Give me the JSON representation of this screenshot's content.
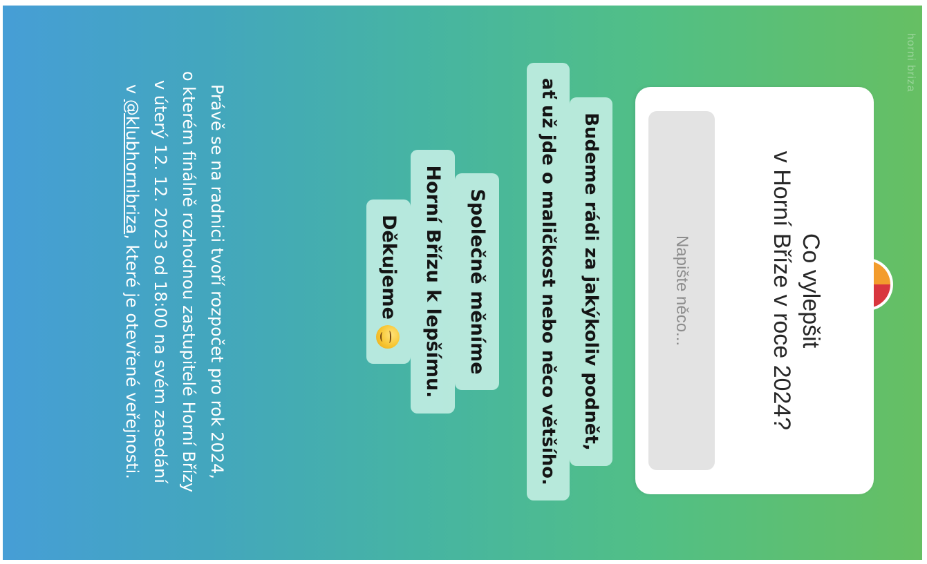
{
  "story": {
    "watermark": "horni briza",
    "question_card": {
      "title_lines": [
        "Co vylepšit",
        "v Horní Bříze v roce 2024?"
      ],
      "input_placeholder": "Napište něco..."
    },
    "highlight_1": {
      "lines": [
        "Budeme rádi za jakýkoliv podnět,",
        "ať už jde o maličkost nebo něco většího."
      ]
    },
    "highlight_2": {
      "lines": [
        "Společně měníme",
        "Horní Břízu k lepšímu.",
        "Děkujeme"
      ],
      "emoji": "relieved-face-emoji"
    },
    "body_text": {
      "line1": "Právě se na radnici tvoří rozpočet pro rok 2024,",
      "line2": "o kterém finálně rozhodnou zastupitelé Horní Břízy",
      "line3": "v úterý 12. 12. 2023 od 18:00 na svém zasedání",
      "line4_prefix": "v ",
      "mention": "@klubhornibriza",
      "line4_suffix": ", které je otevřené veřejnosti."
    },
    "colors": {
      "gradient_top": "#66bf63",
      "gradient_bottom": "#469ed6",
      "highlight_bg": "#c6efe5",
      "card_bg": "#ffffff",
      "input_bg": "#e3e3e3"
    }
  }
}
